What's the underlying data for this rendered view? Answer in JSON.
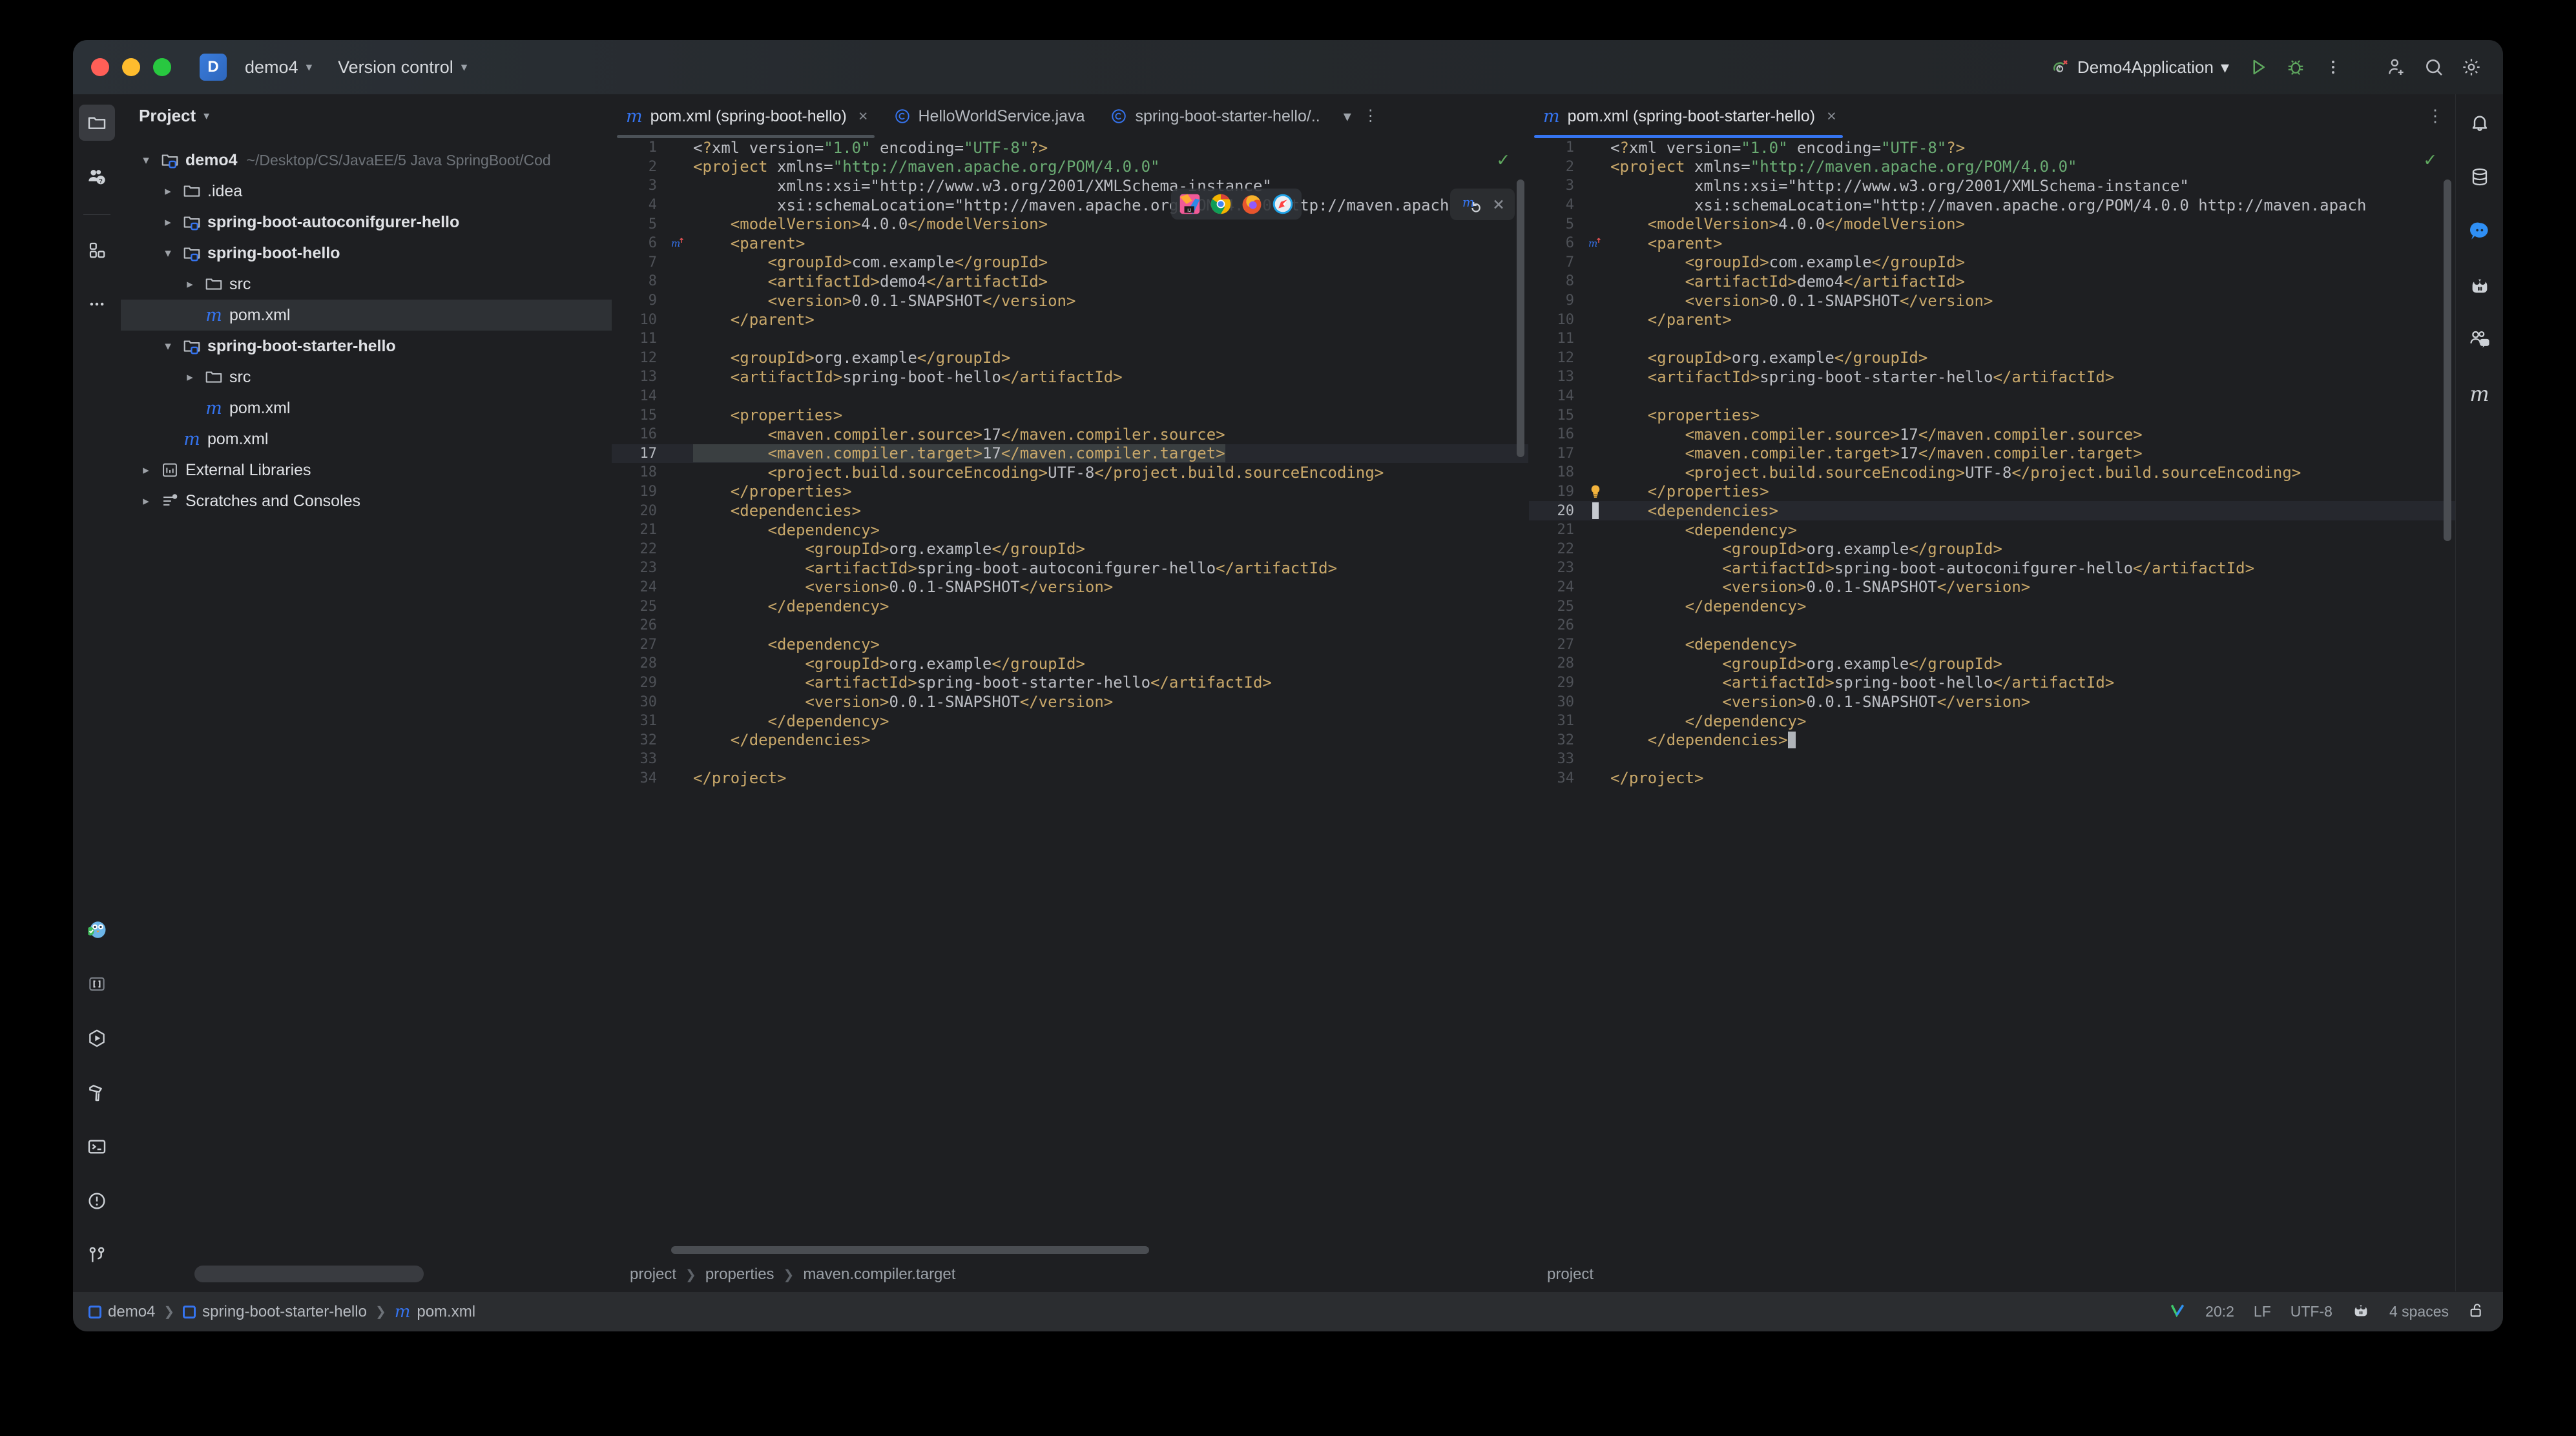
{
  "window": {
    "title_project": "demo4",
    "menu_version_control": "Version control",
    "run_config": "Demo4Application",
    "badge_letter": "D"
  },
  "titlebar_icons": [
    {
      "name": "run-button",
      "glyph": "run"
    },
    {
      "name": "debug-button",
      "glyph": "debug"
    },
    {
      "name": "more-actions-button",
      "glyph": "kebab"
    },
    {
      "name": "code-with-me-button",
      "glyph": "user-plus"
    },
    {
      "name": "search-everywhere-button",
      "glyph": "search"
    },
    {
      "name": "settings-button",
      "glyph": "gear"
    }
  ],
  "left_stripe": [
    {
      "name": "project-tool-button",
      "glyph": "folder",
      "active": true
    },
    {
      "name": "ai-assistant-tool-button",
      "glyph": "assistant",
      "active": false
    },
    {
      "name": "structure-tool-button",
      "glyph": "blocks",
      "active": false
    },
    {
      "name": "more-tool-windows-button",
      "glyph": "dots",
      "active": false
    }
  ],
  "left_stripe_bottom": [
    {
      "name": "bug-assistant-button",
      "glyph": "owl"
    },
    {
      "name": "scratches-button",
      "glyph": "brackets"
    },
    {
      "name": "run-tool-button",
      "glyph": "run-hex"
    },
    {
      "name": "build-tool-button",
      "glyph": "hammer"
    },
    {
      "name": "terminal-tool-button",
      "glyph": "terminal"
    },
    {
      "name": "problems-tool-button",
      "glyph": "warning-circle"
    },
    {
      "name": "version-control-tool-button",
      "glyph": "branch"
    }
  ],
  "right_stripe": [
    {
      "name": "notifications-button",
      "glyph": "bell"
    },
    {
      "name": "database-tool-button",
      "glyph": "database"
    },
    {
      "name": "ai-chat-button",
      "glyph": "chat-bubble"
    },
    {
      "name": "junie-button",
      "glyph": "junie"
    },
    {
      "name": "code-with-me-panel-button",
      "glyph": "people-chat"
    },
    {
      "name": "maven-tool-button",
      "glyph": "maven-m"
    }
  ],
  "project_panel": {
    "header": "Project",
    "tree": [
      {
        "depth": 0,
        "arrow": "down",
        "icon": "module-folder",
        "label": "demo4",
        "bold": true,
        "path": "~/Desktop/CS/JavaEE/5 Java SpringBoot/Cod",
        "selected": false
      },
      {
        "depth": 1,
        "arrow": "right",
        "icon": "folder",
        "label": ".idea",
        "bold": false,
        "path": "",
        "selected": false
      },
      {
        "depth": 1,
        "arrow": "right",
        "icon": "module-folder",
        "label": "spring-boot-autoconifgurer-hello",
        "bold": true,
        "path": "",
        "selected": false
      },
      {
        "depth": 1,
        "arrow": "down",
        "icon": "module-folder",
        "label": "spring-boot-hello",
        "bold": true,
        "path": "",
        "selected": false
      },
      {
        "depth": 2,
        "arrow": "right",
        "icon": "folder",
        "label": "src",
        "bold": false,
        "path": "",
        "selected": false
      },
      {
        "depth": 2,
        "arrow": "none",
        "icon": "maven-m",
        "label": "pom.xml",
        "bold": false,
        "path": "",
        "selected": true
      },
      {
        "depth": 1,
        "arrow": "down",
        "icon": "module-folder",
        "label": "spring-boot-starter-hello",
        "bold": true,
        "path": "",
        "selected": false
      },
      {
        "depth": 2,
        "arrow": "right",
        "icon": "folder",
        "label": "src",
        "bold": false,
        "path": "",
        "selected": false
      },
      {
        "depth": 2,
        "arrow": "none",
        "icon": "maven-m",
        "label": "pom.xml",
        "bold": false,
        "path": "",
        "selected": false
      },
      {
        "depth": 1,
        "arrow": "none",
        "icon": "maven-m",
        "label": "pom.xml",
        "bold": false,
        "path": "",
        "selected": false
      },
      {
        "depth": 0,
        "arrow": "right",
        "icon": "libraries",
        "label": "External Libraries",
        "bold": false,
        "path": "",
        "selected": false
      },
      {
        "depth": 0,
        "arrow": "right",
        "icon": "scratches",
        "label": "Scratches and Consoles",
        "bold": false,
        "path": "",
        "selected": false
      }
    ]
  },
  "editor_left": {
    "tabs": [
      {
        "label": "pom.xml (spring-boot-hello)",
        "icon": "maven-m",
        "active": true,
        "closable": true
      },
      {
        "label": "HelloWorldService.java",
        "icon": "class-c",
        "active": false,
        "closable": false
      },
      {
        "label": "spring-boot-starter-hello/..",
        "icon": "class-c",
        "active": false,
        "closable": false
      }
    ],
    "breadcrumb": [
      "project",
      "properties",
      "maven.compiler.target"
    ],
    "inspection_ok": true,
    "selected_line": 17,
    "lines": [
      {
        "n": 1,
        "indent": 0,
        "text": "<?xml version=\"1.0\" encoding=\"UTF-8\"?>"
      },
      {
        "n": 2,
        "indent": 0,
        "text": "<project xmlns=\"http://maven.apache.org/POM/4.0.0\""
      },
      {
        "n": 3,
        "indent": 0,
        "text": "         xmlns:xsi=\"http://www.w3.org/2001/XMLSchema-instance\""
      },
      {
        "n": 4,
        "indent": 0,
        "text": "         xsi:schemaLocation=\"http://maven.apache.org/POM/4.0.0 http://maven.apach"
      },
      {
        "n": 5,
        "indent": 1,
        "text": "    <modelVersion>4.0.0</modelVersion>"
      },
      {
        "n": 6,
        "indent": 1,
        "text": "    <parent>"
      },
      {
        "n": 7,
        "indent": 2,
        "text": "        <groupId>com.example</groupId>"
      },
      {
        "n": 8,
        "indent": 2,
        "text": "        <artifactId>demo4</artifactId>"
      },
      {
        "n": 9,
        "indent": 2,
        "text": "        <version>0.0.1-SNAPSHOT</version>"
      },
      {
        "n": 10,
        "indent": 1,
        "text": "    </parent>"
      },
      {
        "n": 11,
        "indent": 0,
        "text": ""
      },
      {
        "n": 12,
        "indent": 1,
        "text": "    <groupId>org.example</groupId>"
      },
      {
        "n": 13,
        "indent": 1,
        "text": "    <artifactId>spring-boot-hello</artifactId>"
      },
      {
        "n": 14,
        "indent": 0,
        "text": ""
      },
      {
        "n": 15,
        "indent": 1,
        "text": "    <properties>"
      },
      {
        "n": 16,
        "indent": 2,
        "text": "        <maven.compiler.source>17</maven.compiler.source>"
      },
      {
        "n": 17,
        "indent": 2,
        "text": "        <maven.compiler.target>17</maven.compiler.target>"
      },
      {
        "n": 18,
        "indent": 2,
        "text": "        <project.build.sourceEncoding>UTF-8</project.build.sourceEncoding>"
      },
      {
        "n": 19,
        "indent": 1,
        "text": "    </properties>"
      },
      {
        "n": 20,
        "indent": 1,
        "text": "    <dependencies>"
      },
      {
        "n": 21,
        "indent": 2,
        "text": "        <dependency>"
      },
      {
        "n": 22,
        "indent": 3,
        "text": "            <groupId>org.example</groupId>"
      },
      {
        "n": 23,
        "indent": 3,
        "text": "            <artifactId>spring-boot-autoconifgurer-hello</artifactId>"
      },
      {
        "n": 24,
        "indent": 3,
        "text": "            <version>0.0.1-SNAPSHOT</version>"
      },
      {
        "n": 25,
        "indent": 2,
        "text": "        </dependency>"
      },
      {
        "n": 26,
        "indent": 0,
        "text": ""
      },
      {
        "n": 27,
        "indent": 2,
        "text": "        <dependency>"
      },
      {
        "n": 28,
        "indent": 3,
        "text": "            <groupId>org.example</groupId>"
      },
      {
        "n": 29,
        "indent": 3,
        "text": "            <artifactId>spring-boot-starter-hello</artifactId>"
      },
      {
        "n": 30,
        "indent": 3,
        "text": "            <version>0.0.1-SNAPSHOT</version>"
      },
      {
        "n": 31,
        "indent": 2,
        "text": "        </dependency>"
      },
      {
        "n": 32,
        "indent": 1,
        "text": "    </dependencies>"
      },
      {
        "n": 33,
        "indent": 0,
        "text": ""
      },
      {
        "n": 34,
        "indent": 0,
        "text": "</project>"
      }
    ]
  },
  "editor_right": {
    "tabs": [
      {
        "label": "pom.xml (spring-boot-starter-hello)",
        "icon": "maven-m",
        "active": true,
        "closable": true
      }
    ],
    "breadcrumb": [
      "project"
    ],
    "inspection_ok": true,
    "caret_line": 20,
    "bulb_line": 19,
    "lines": [
      {
        "n": 1,
        "indent": 0,
        "text": "<?xml version=\"1.0\" encoding=\"UTF-8\"?>"
      },
      {
        "n": 2,
        "indent": 0,
        "text": "<project xmlns=\"http://maven.apache.org/POM/4.0.0\""
      },
      {
        "n": 3,
        "indent": 0,
        "text": "         xmlns:xsi=\"http://www.w3.org/2001/XMLSchema-instance\""
      },
      {
        "n": 4,
        "indent": 0,
        "text": "         xsi:schemaLocation=\"http://maven.apache.org/POM/4.0.0 http://maven.apach"
      },
      {
        "n": 5,
        "indent": 1,
        "text": "    <modelVersion>4.0.0</modelVersion>"
      },
      {
        "n": 6,
        "indent": 1,
        "text": "    <parent>"
      },
      {
        "n": 7,
        "indent": 2,
        "text": "        <groupId>com.example</groupId>"
      },
      {
        "n": 8,
        "indent": 2,
        "text": "        <artifactId>demo4</artifactId>"
      },
      {
        "n": 9,
        "indent": 2,
        "text": "        <version>0.0.1-SNAPSHOT</version>"
      },
      {
        "n": 10,
        "indent": 1,
        "text": "    </parent>"
      },
      {
        "n": 11,
        "indent": 0,
        "text": ""
      },
      {
        "n": 12,
        "indent": 1,
        "text": "    <groupId>org.example</groupId>"
      },
      {
        "n": 13,
        "indent": 1,
        "text": "    <artifactId>spring-boot-starter-hello</artifactId>"
      },
      {
        "n": 14,
        "indent": 0,
        "text": ""
      },
      {
        "n": 15,
        "indent": 1,
        "text": "    <properties>"
      },
      {
        "n": 16,
        "indent": 2,
        "text": "        <maven.compiler.source>17</maven.compiler.source>"
      },
      {
        "n": 17,
        "indent": 2,
        "text": "        <maven.compiler.target>17</maven.compiler.target>"
      },
      {
        "n": 18,
        "indent": 2,
        "text": "        <project.build.sourceEncoding>UTF-8</project.build.sourceEncoding>"
      },
      {
        "n": 19,
        "indent": 1,
        "text": "    </properties>"
      },
      {
        "n": 20,
        "indent": 1,
        "text": "    <dependencies>"
      },
      {
        "n": 21,
        "indent": 2,
        "text": "        <dependency>"
      },
      {
        "n": 22,
        "indent": 3,
        "text": "            <groupId>org.example</groupId>"
      },
      {
        "n": 23,
        "indent": 3,
        "text": "            <artifactId>spring-boot-autoconifgurer-hello</artifactId>"
      },
      {
        "n": 24,
        "indent": 3,
        "text": "            <version>0.0.1-SNAPSHOT</version>"
      },
      {
        "n": 25,
        "indent": 2,
        "text": "        </dependency>"
      },
      {
        "n": 26,
        "indent": 0,
        "text": ""
      },
      {
        "n": 27,
        "indent": 2,
        "text": "        <dependency>"
      },
      {
        "n": 28,
        "indent": 3,
        "text": "            <groupId>org.example</groupId>"
      },
      {
        "n": 29,
        "indent": 3,
        "text": "            <artifactId>spring-boot-hello</artifactId>"
      },
      {
        "n": 30,
        "indent": 3,
        "text": "            <version>0.0.1-SNAPSHOT</version>"
      },
      {
        "n": 31,
        "indent": 2,
        "text": "        </dependency>"
      },
      {
        "n": 32,
        "indent": 1,
        "text": "    </dependencies>"
      },
      {
        "n": 33,
        "indent": 0,
        "text": ""
      },
      {
        "n": 34,
        "indent": 0,
        "text": "</project>"
      }
    ]
  },
  "code_overlay": {
    "browser_icons": [
      "intellij-icon",
      "chrome-icon",
      "firefox-icon",
      "safari-icon"
    ],
    "maven_reload_label": "maven-reload-icon",
    "close_label": "×"
  },
  "statusbar": {
    "crumbs": [
      "demo4",
      "spring-boot-starter-hello",
      "pom.xml"
    ],
    "caret_position": "20:2",
    "line_separator": "LF",
    "encoding": "UTF-8",
    "indent": "4 spaces",
    "inspection_badge": "V"
  }
}
